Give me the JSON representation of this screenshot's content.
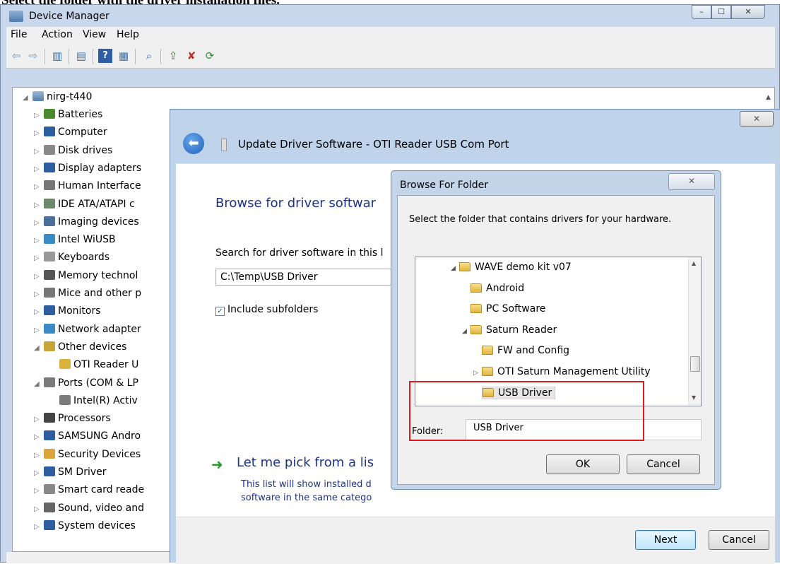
{
  "caption": "Select the folder with the driver installation files.",
  "device_manager": {
    "title": "Device Manager",
    "min_glyph": "–",
    "max_glyph": "☐",
    "close_glyph": "✕",
    "menu": [
      "File",
      "Action",
      "View",
      "Help"
    ],
    "tree_root": "nirg-t440",
    "tree_items": [
      {
        "label": "Batteries",
        "expander": "▷",
        "depth": 1,
        "color": "#4a8a2e"
      },
      {
        "label": "Computer",
        "expander": "▷",
        "depth": 1,
        "color": "#2d5fa0"
      },
      {
        "label": "Disk drives",
        "expander": "▷",
        "depth": 1,
        "color": "#888888"
      },
      {
        "label": "Display adapters",
        "expander": "▷",
        "depth": 1,
        "color": "#2d5fa0"
      },
      {
        "label": "Human Interface",
        "expander": "▷",
        "depth": 1,
        "color": "#777777"
      },
      {
        "label": "IDE ATA/ATAPI c",
        "expander": "▷",
        "depth": 1,
        "color": "#6a8a6a"
      },
      {
        "label": "Imaging devices",
        "expander": "▷",
        "depth": 1,
        "color": "#4b6f9c"
      },
      {
        "label": "Intel WiUSB",
        "expander": "▷",
        "depth": 1,
        "color": "#3a8ac7"
      },
      {
        "label": "Keyboards",
        "expander": "▷",
        "depth": 1,
        "color": "#999999"
      },
      {
        "label": "Memory technol",
        "expander": "▷",
        "depth": 1,
        "color": "#555555"
      },
      {
        "label": "Mice and other p",
        "expander": "▷",
        "depth": 1,
        "color": "#777777"
      },
      {
        "label": "Monitors",
        "expander": "▷",
        "depth": 1,
        "color": "#2d5fa0"
      },
      {
        "label": "Network adapter",
        "expander": "▷",
        "depth": 1,
        "color": "#3a8ac7"
      },
      {
        "label": "Other devices",
        "expander": "◢",
        "depth": 1,
        "color": "#c9a43a"
      },
      {
        "label": "OTI Reader U",
        "expander": "",
        "depth": 2,
        "color": "#d9b23c"
      },
      {
        "label": "Ports (COM & LP",
        "expander": "◢",
        "depth": 1,
        "color": "#7a7a7a"
      },
      {
        "label": "Intel(R) Activ",
        "expander": "",
        "depth": 2,
        "color": "#7a7a7a"
      },
      {
        "label": "Processors",
        "expander": "▷",
        "depth": 1,
        "color": "#444444"
      },
      {
        "label": "SAMSUNG Andro",
        "expander": "▷",
        "depth": 1,
        "color": "#2d5fa0"
      },
      {
        "label": "Security Devices",
        "expander": "▷",
        "depth": 1,
        "color": "#d9a43a"
      },
      {
        "label": "SM Driver",
        "expander": "▷",
        "depth": 1,
        "color": "#2d5fa0"
      },
      {
        "label": "Smart card reade",
        "expander": "▷",
        "depth": 1,
        "color": "#888888"
      },
      {
        "label": "Sound, video and",
        "expander": "▷",
        "depth": 1,
        "color": "#666666"
      },
      {
        "label": "System devices",
        "expander": "▷",
        "depth": 1,
        "color": "#2d5fa0"
      }
    ]
  },
  "update_driver": {
    "close_glyph": "✕",
    "back_glyph": "⬅",
    "title": "Update Driver Software - OTI Reader USB Com Port",
    "heading": "Browse for driver softwar",
    "search_label": "Search for driver software in this l",
    "path_value": "C:\\Temp\\USB Driver",
    "include_subfolders": "Include subfolders",
    "check_glyph": "✓",
    "pick_arrow": "➜",
    "pick_heading": "Let me pick from a lis",
    "pick_desc_1": "This list will show installed d",
    "pick_desc_2": "software in the same catego",
    "next_label": "Next",
    "cancel_label": "Cancel"
  },
  "browse_folder": {
    "title": "Browse For Folder",
    "close_glyph": "✕",
    "instruction": "Select the folder that contains drivers for your hardware.",
    "tree": [
      {
        "label": "WAVE demo kit v07",
        "expander": "◢",
        "indent": 0
      },
      {
        "label": "Android",
        "expander": "",
        "indent": 1
      },
      {
        "label": "PC Software",
        "expander": "",
        "indent": 1
      },
      {
        "label": "Saturn Reader",
        "expander": "◢",
        "indent": 1
      },
      {
        "label": "FW and Config",
        "expander": "",
        "indent": 2
      },
      {
        "label": "OTI Saturn Management Utility",
        "expander": "▷",
        "indent": 2
      },
      {
        "label": "USB Driver",
        "expander": "",
        "indent": 2,
        "selected": true
      }
    ],
    "folder_label": "Folder:",
    "folder_value": "USB Driver",
    "ok_label": "OK",
    "cancel_label": "Cancel",
    "scroll_up": "▲",
    "scroll_down": "▼"
  }
}
